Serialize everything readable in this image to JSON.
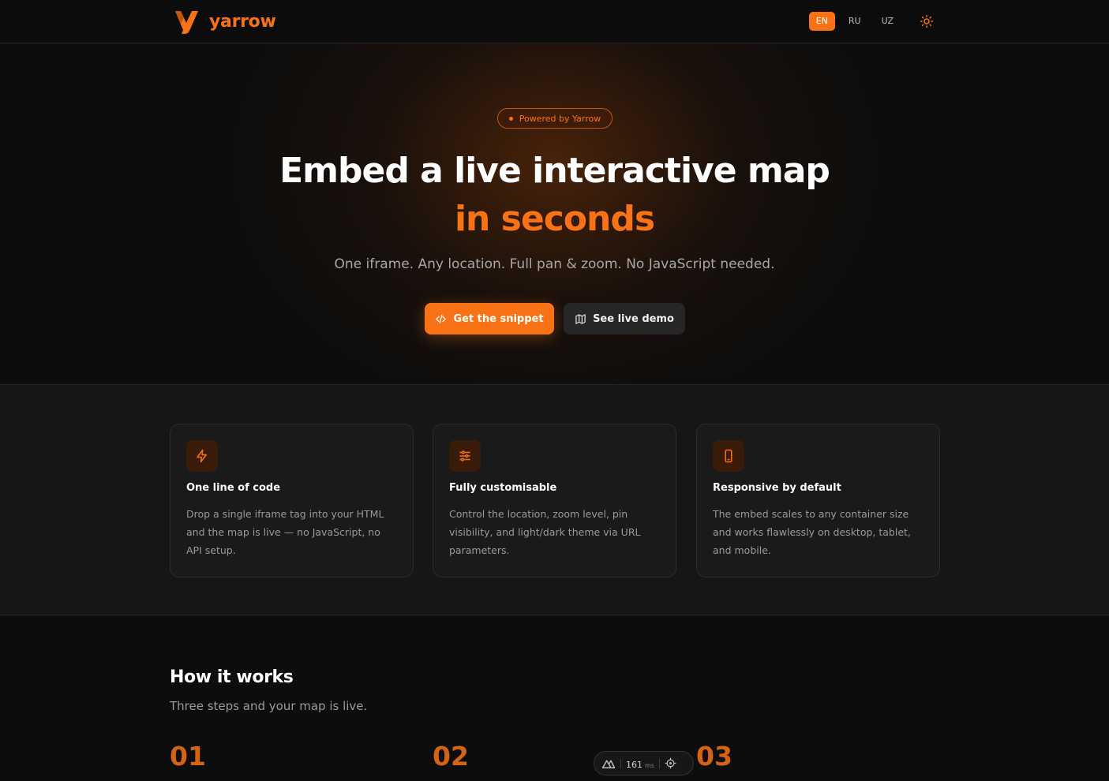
{
  "header": {
    "brand": "yarrow",
    "languages": [
      "EN",
      "RU",
      "UZ"
    ],
    "active_language": "EN",
    "theme_icon": "sun-icon"
  },
  "hero": {
    "badge": "Powered by Yarrow",
    "title_line1": "Embed a live interactive map",
    "title_line2": "in seconds",
    "subtitle": "One iframe. Any location. Full pan & zoom. No JavaScript needed.",
    "primary_button": "Get the snippet",
    "primary_icon": "code-icon",
    "secondary_button": "See live demo",
    "secondary_icon": "map-icon"
  },
  "features": [
    {
      "icon": "lightning-icon",
      "title": "One line of code",
      "description": "Drop a single iframe tag into your HTML and the map is live — no JavaScript, no API setup."
    },
    {
      "icon": "sliders-icon",
      "title": "Fully customisable",
      "description": "Control the location, zoom level, pin visibility, and light/dark theme via URL parameters."
    },
    {
      "icon": "smartphone-icon",
      "title": "Responsive by default",
      "description": "The embed scales to any container size and works flawlessly on desktop, tablet, and mobile."
    }
  ],
  "how_it_works": {
    "title": "How it works",
    "subtitle": "Three steps and your map is live.",
    "steps": [
      "01",
      "02",
      "03"
    ]
  },
  "dev_toolbar": {
    "latency_value": "161",
    "latency_unit": "ms"
  },
  "colors": {
    "accent": "#f97316",
    "background": "#141414",
    "card": "#1a1a1a"
  }
}
